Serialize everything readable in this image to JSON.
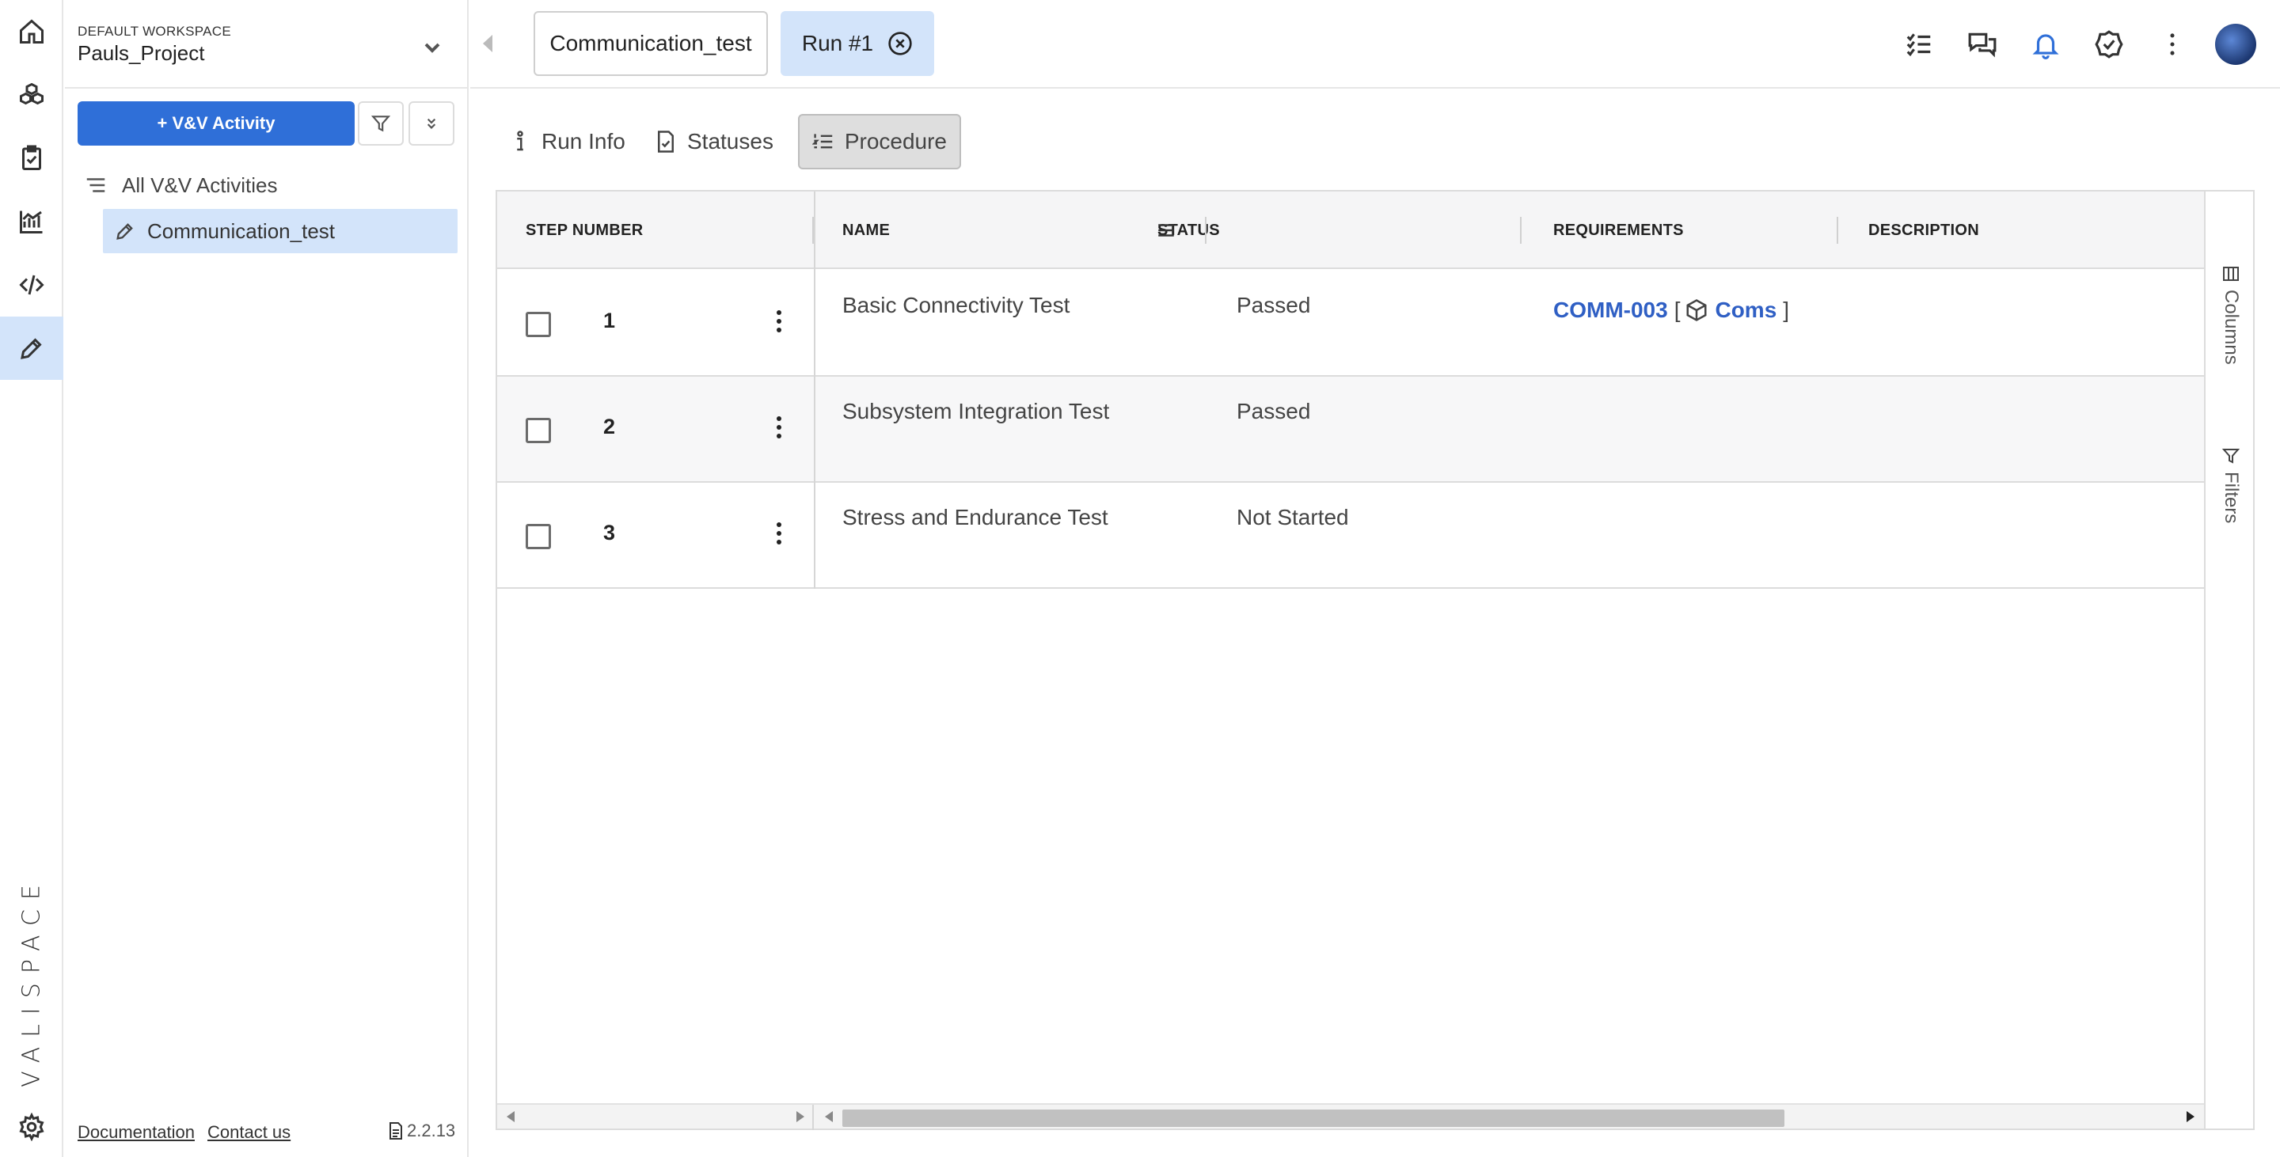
{
  "workspace": {
    "label": "DEFAULT WORKSPACE",
    "project": "Pauls_Project"
  },
  "sidebar": {
    "add_button": "+ V&V Activity",
    "tree": {
      "all_label": "All V&V Activities",
      "items": [
        {
          "label": "Communication_test"
        }
      ]
    },
    "footer": {
      "documentation": "Documentation",
      "contact": "Contact us",
      "version": "2.2.13"
    }
  },
  "brand": "VALISPACE",
  "topbar": {
    "tabs": [
      {
        "label": "Communication_test"
      },
      {
        "label": "Run #1"
      }
    ]
  },
  "subtabs": [
    {
      "label": "Run Info",
      "icon": "info-icon"
    },
    {
      "label": "Statuses",
      "icon": "clipboard-check-icon"
    },
    {
      "label": "Procedure",
      "icon": "numbered-list-icon"
    }
  ],
  "grid": {
    "columns": [
      "STEP NUMBER",
      "NAME",
      "STATUS",
      "REQUIREMENTS",
      "DESCRIPTION"
    ],
    "rows": [
      {
        "step": "1",
        "name": "Basic Connectivity Test",
        "status": "Passed",
        "req_id": "COMM-003",
        "req_open": "[",
        "req_component": "Coms",
        "req_close": "]"
      },
      {
        "step": "2",
        "name": "Subsystem Integration Test",
        "status": "Passed"
      },
      {
        "step": "3",
        "name": "Stress and Endurance Test",
        "status": "Not Started"
      }
    ]
  },
  "sidepanel": {
    "columns": "Columns",
    "filters": "Filters"
  },
  "colors": {
    "accent": "#2f6fd8",
    "selected_bg": "#d3e4fa",
    "link": "#2f5fc4"
  }
}
